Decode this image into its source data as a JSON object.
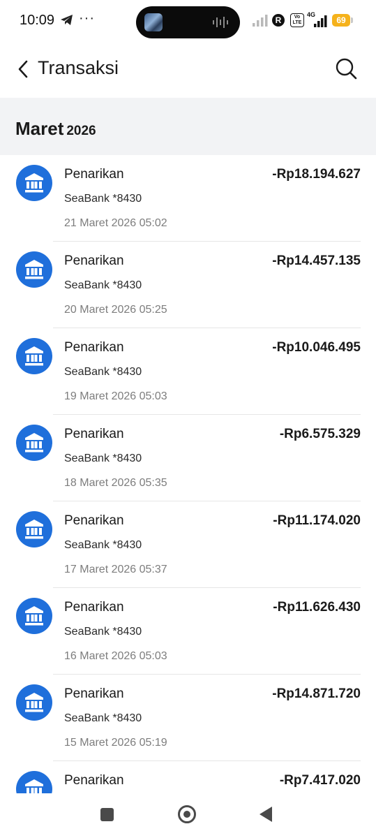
{
  "status_bar": {
    "time": "10:09",
    "overflow": "···",
    "indicator_r": "R",
    "volte": "Vo LTE",
    "network": "4G",
    "battery": "69",
    "icons": [
      "telegram-icon",
      "signal-icon",
      "battery-icon"
    ]
  },
  "header": {
    "title": "Transaksi",
    "back_icon": "chevron-left-icon",
    "search_icon": "search-icon"
  },
  "section": {
    "month": "Maret",
    "year": "2026"
  },
  "accent_color": "#1f6fdb",
  "transactions": [
    {
      "title": "Penarikan",
      "account": "SeaBank *8430",
      "date": "21 Maret 2026 05:02",
      "amount": "-Rp18.194.627"
    },
    {
      "title": "Penarikan",
      "account": "SeaBank *8430",
      "date": "20 Maret 2026 05:25",
      "amount": "-Rp14.457.135"
    },
    {
      "title": "Penarikan",
      "account": "SeaBank *8430",
      "date": "19 Maret 2026 05:03",
      "amount": "-Rp10.046.495"
    },
    {
      "title": "Penarikan",
      "account": "SeaBank *8430",
      "date": "18 Maret 2026 05:35",
      "amount": "-Rp6.575.329"
    },
    {
      "title": "Penarikan",
      "account": "SeaBank *8430",
      "date": "17 Maret 2026 05:37",
      "amount": "-Rp11.174.020"
    },
    {
      "title": "Penarikan",
      "account": "SeaBank *8430",
      "date": "16 Maret 2026 05:03",
      "amount": "-Rp11.626.430"
    },
    {
      "title": "Penarikan",
      "account": "SeaBank *8430",
      "date": "15 Maret 2026 05:19",
      "amount": "-Rp14.871.720"
    },
    {
      "title": "Penarikan",
      "account": "",
      "date": "",
      "amount": "-Rp7.417.020"
    }
  ],
  "nav": {
    "icons": [
      "recents-icon",
      "home-icon",
      "back-icon"
    ]
  }
}
